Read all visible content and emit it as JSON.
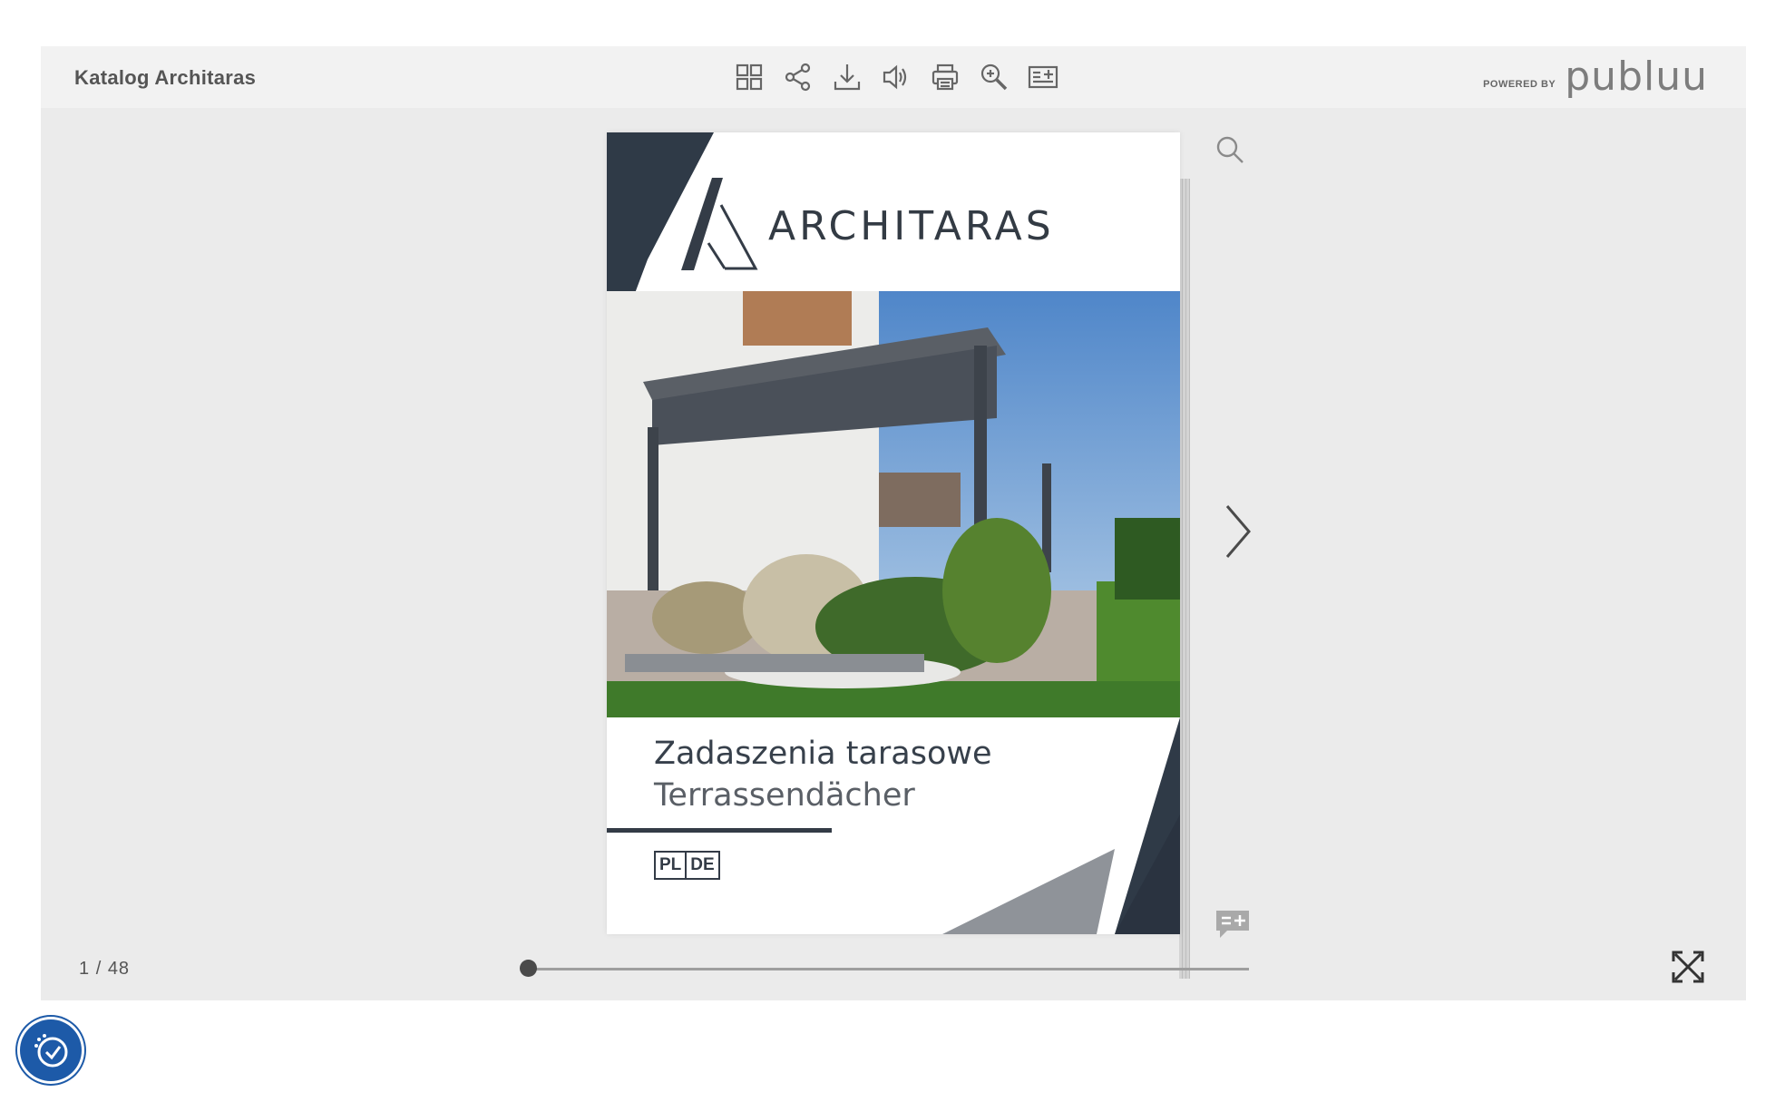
{
  "header": {
    "title": "Katalog Architaras",
    "powered_prefix": "POWERED BY",
    "powered_brand": "publuu"
  },
  "toolbar": [
    {
      "name": "thumbnails-icon"
    },
    {
      "name": "share-icon"
    },
    {
      "name": "download-icon"
    },
    {
      "name": "sound-icon"
    },
    {
      "name": "print-icon"
    },
    {
      "name": "zoom-in-icon"
    },
    {
      "name": "add-note-icon"
    }
  ],
  "page": {
    "brand": "ARCHITARAS",
    "title_pl": "Zadaszenia tarasowe",
    "title_de": "Terrassendächer",
    "lang_a": "PL",
    "lang_b": "DE"
  },
  "pager": {
    "current": "1",
    "separator": "/",
    "total": "48",
    "progress": 0
  },
  "colors": {
    "viewer_bg": "#ebebeb",
    "navy": "#333b46",
    "accessibility": "#1d5aa8"
  }
}
